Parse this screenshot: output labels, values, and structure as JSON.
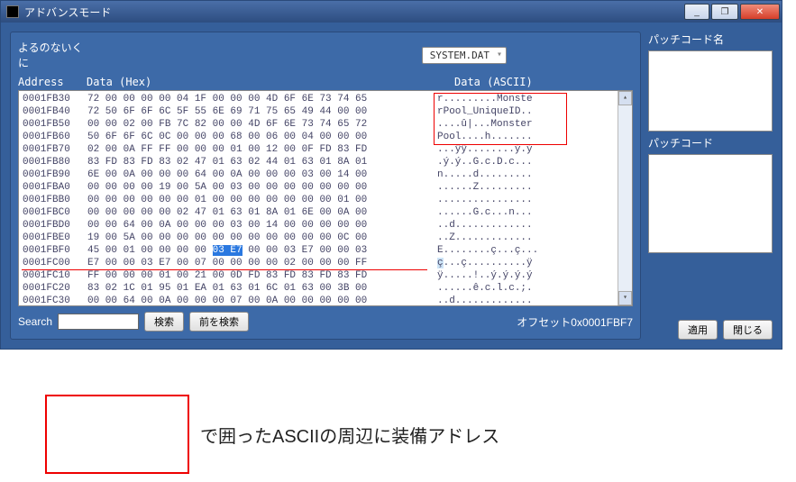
{
  "titlebar": {
    "title": "アドバンスモード"
  },
  "winbuttons": {
    "min": "_",
    "max": "❐",
    "close": "✕"
  },
  "panel": {
    "label1": "よるのないくに",
    "col_addr": "Address",
    "col_hex": "Data (Hex)",
    "col_asc": "Data (ASCII)",
    "dropdown": "SYSTEM.DAT"
  },
  "rows": [
    {
      "a": "0001FB30",
      "h": "72 00 00 00 00 04 1F 00 00 00 4D 6F 6E 73 74 65",
      "s": "r.........Monste"
    },
    {
      "a": "0001FB40",
      "h": "72 50 6F 6F 6C 5F 55 6E 69 71 75 65 49 44 00 00",
      "s": "rPool_UniqueID.."
    },
    {
      "a": "0001FB50",
      "h": "00 00 02 00 FB 7C 82 00 00 4D 6F 6E 73 74 65 72",
      "s": "....û|...Monster"
    },
    {
      "a": "0001FB60",
      "h": "50 6F 6F 6C 0C 00 00 00 68 00 06 00 04 00 00 00",
      "s": "Pool....h......."
    },
    {
      "a": "0001FB70",
      "h": "02 00 0A FF FF 00 00 00 01 00 12 00 0F FD 83 FD",
      "s": "...ÿÿ........ý.ý"
    },
    {
      "a": "0001FB80",
      "h": "83 FD 83 FD 83 02 47 01 63 02 44 01 63 01 8A 01",
      "s": ".ý.ý..G.c.D.c..."
    },
    {
      "a": "0001FB90",
      "h": "6E 00 0A 00 00 00 64 00 0A 00 00 00 03 00 14 00",
      "s": "n.....d........."
    },
    {
      "a": "0001FBA0",
      "h": "00 00 00 00 19 00 5A 00 03 00 00 00 00 00 00 00",
      "s": "......Z........."
    },
    {
      "a": "0001FBB0",
      "h": "00 00 00 00 00 00 01 00 00 00 00 00 00 00 01 00",
      "s": "................"
    },
    {
      "a": "0001FBC0",
      "h": "00 00 00 00 00 02 47 01 63 01 8A 01 6E 00 0A 00",
      "s": "......G.c...n..."
    },
    {
      "a": "0001FBD0",
      "h": "00 00 64 00 0A 00 00 00 03 00 14 00 00 00 00 00",
      "s": "..d............."
    },
    {
      "a": "0001FBE0",
      "h": "19 00 5A 00 00 00 00 00 00 00 00 00 00 00 0C 00",
      "s": "..Z............."
    },
    {
      "a": "0001FBF0",
      "h": "45 00 01 00 00 00 00 ",
      "h2": "03 E7",
      "h3": " 00 00 03 E7 00 00 03",
      "s": "E........ç...ç...",
      "hi": true
    },
    {
      "a": "0001FC00",
      "h": "E7 00 00 03 E7 00 07 00 00 00 00 02 00 00 00 FF",
      "s": "ç...ç..........ÿ"
    },
    {
      "a": "0001FC10",
      "h": "FF 00 00 00 01 00 21 00 0D FD 83 FD 83 FD 83 FD",
      "s": "ÿ.....!..ý.ý.ý.ý"
    },
    {
      "a": "0001FC20",
      "h": "83 02 1C 01 95 01 EA 01 63 01 6C 01 63 00 3B 00",
      "s": "......ê.c.l.c.;."
    },
    {
      "a": "0001FC30",
      "h": "00 00 64 00 0A 00 00 00 07 00 0A 00 00 00 00 00",
      "s": "..d............."
    }
  ],
  "search": {
    "label": "Search",
    "btn_search": "検索",
    "btn_prev": "前を検索",
    "offset": "オフセット0x0001FBF7"
  },
  "side": {
    "label1": "パッチコード名",
    "label2": "パッチコード",
    "btn_apply": "適用",
    "btn_close": "閉じる"
  },
  "below_text": "で囲ったASCIIの周辺に装備アドレス"
}
